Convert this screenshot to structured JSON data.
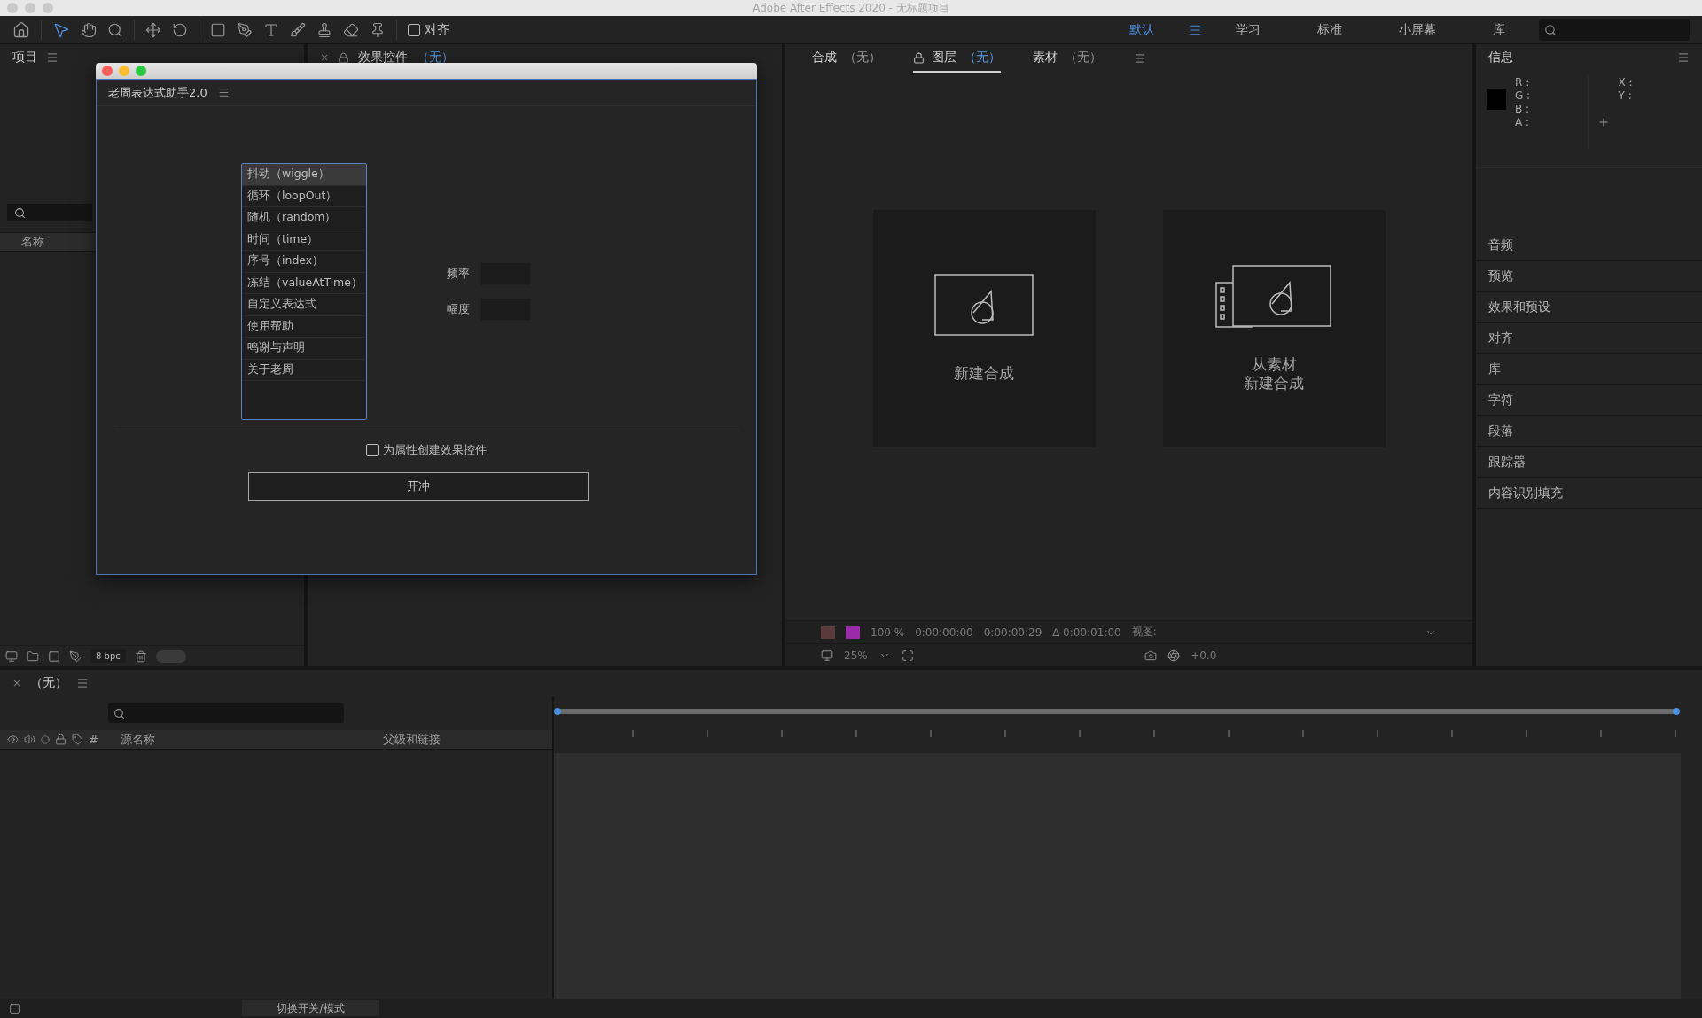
{
  "app_title": "Adobe After Effects 2020 - 无标题项目",
  "toolbar": {
    "align_checkbox": {
      "label": "对齐",
      "checked": false
    },
    "workspaces": [
      {
        "label": "默认",
        "selected": true
      },
      {
        "label": "学习",
        "selected": false
      },
      {
        "label": "标准",
        "selected": false
      },
      {
        "label": "小屏幕",
        "selected": false
      },
      {
        "label": "库",
        "selected": false
      }
    ]
  },
  "project_panel": {
    "title": "项目",
    "column": "名称",
    "bit_depth": "8 bpc"
  },
  "effect_panel": {
    "close_glyph": "×",
    "title": "效果控件",
    "suffix": "（无）"
  },
  "viewer": {
    "tabs": [
      {
        "label": "合成",
        "suffix": "（无）",
        "selected": false
      },
      {
        "label": "图层",
        "suffix": "（无）",
        "selected": true
      },
      {
        "label": "素材",
        "suffix": "（无）",
        "selected": false
      }
    ],
    "cards": [
      {
        "kind": "comp",
        "label": [
          "新建合成"
        ]
      },
      {
        "kind": "footage",
        "label": [
          "从素材",
          "新建合成"
        ]
      }
    ],
    "zoom_percent": "100 %",
    "time_in": "0:00:00:00",
    "time_out": "0:00:00:29",
    "duration": "∆ 0:00:01:00",
    "view_label": "视图:",
    "magnification": "25%",
    "exposure": "+0.0"
  },
  "info_panel": {
    "title": "信息",
    "color_labels": [
      "R :",
      "G :",
      "B :",
      "A :"
    ],
    "position_labels": [
      "X :",
      "Y :"
    ],
    "sections": [
      "音频",
      "预览",
      "效果和预设",
      "对齐",
      "库",
      "字符",
      "段落",
      "跟踪器",
      "内容识别填充"
    ]
  },
  "timeline": {
    "close_glyph": "×",
    "title": "（无）",
    "columns": [
      "#",
      "源名称",
      "父级和链接"
    ],
    "toggle_label": "切换开关/模式"
  },
  "dialog": {
    "title": "老周表达式助手2.0",
    "items": [
      {
        "label": "抖动（wiggle）",
        "selected": true
      },
      {
        "label": "循环（loopOut）",
        "selected": false
      },
      {
        "label": "随机（random）",
        "selected": false
      },
      {
        "label": "时间（time）",
        "selected": false
      },
      {
        "label": "序号（index）",
        "selected": false
      },
      {
        "label": "冻结（valueAtTime）",
        "selected": false
      },
      {
        "label": "自定义表达式",
        "selected": false
      },
      {
        "label": "使用帮助",
        "selected": false
      },
      {
        "label": "鸣谢与声明",
        "selected": false
      },
      {
        "label": "关于老周",
        "selected": false
      }
    ],
    "fields": [
      {
        "label": "频率"
      },
      {
        "label": "幅度"
      }
    ],
    "checkbox": {
      "label": "为属性创建效果控件",
      "checked": false
    },
    "button": "开冲"
  }
}
